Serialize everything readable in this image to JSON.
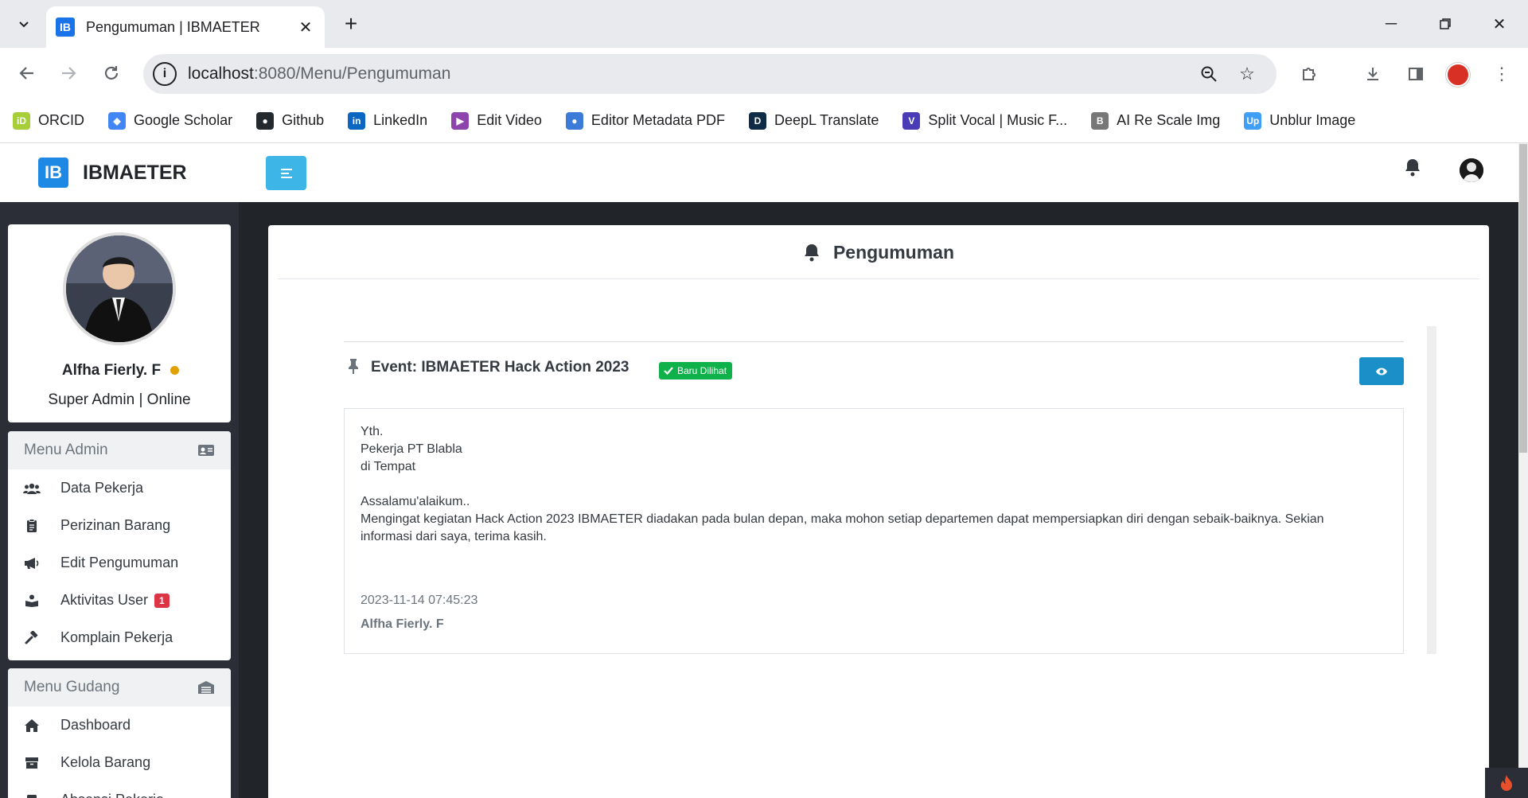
{
  "browser": {
    "tab_title": "Pengumuman | IBMAETER",
    "tab_favicon": "IB",
    "url_host": "localhost",
    "url_rest": ":8080/Menu/Pengumuman",
    "bookmarks": [
      {
        "label": "ORCID",
        "icon": "orcid-icon",
        "color": "#a6ce39",
        "glyph": "iD"
      },
      {
        "label": "Google Scholar",
        "icon": "scholar-icon",
        "color": "#4285f4",
        "glyph": "◆"
      },
      {
        "label": "Github",
        "icon": "github-icon",
        "color": "#24292e",
        "glyph": "●"
      },
      {
        "label": "LinkedIn",
        "icon": "linkedin-icon",
        "color": "#0a66c2",
        "glyph": "in"
      },
      {
        "label": "Edit Video",
        "icon": "edit-video-icon",
        "color": "#8e44ad",
        "glyph": "▶"
      },
      {
        "label": "Editor Metadata PDF",
        "icon": "metadata-icon",
        "color": "#3d7bd9",
        "glyph": "●"
      },
      {
        "label": "DeepL Translate",
        "icon": "deepl-icon",
        "color": "#0f2b46",
        "glyph": "D"
      },
      {
        "label": "Split Vocal | Music F...",
        "icon": "split-vocal-icon",
        "color": "#4a3bb7",
        "glyph": "V"
      },
      {
        "label": "AI Re Scale Img",
        "icon": "rescale-icon",
        "color": "#777777",
        "glyph": "B"
      },
      {
        "label": "Unblur Image",
        "icon": "unblur-icon",
        "color": "#3f9ef5",
        "glyph": "Up"
      }
    ]
  },
  "app": {
    "brand_logo": "IB",
    "brand_name": "IBMAETER",
    "accent": "#3db5e6",
    "profile": {
      "name": "Alfha Fierly. F",
      "role": "Super Admin | Online",
      "status_color": "#e0a000"
    },
    "menu_admin": {
      "title": "Menu Admin",
      "items": [
        {
          "label": "Data Pekerja",
          "icon": "users-icon"
        },
        {
          "label": "Perizinan Barang",
          "icon": "clipboard-icon"
        },
        {
          "label": "Edit Pengumuman",
          "icon": "megaphone-icon"
        },
        {
          "label": "Aktivitas User",
          "icon": "user-activity-icon",
          "badge": "1"
        },
        {
          "label": "Komplain Pekerja",
          "icon": "gavel-icon"
        }
      ]
    },
    "menu_gudang": {
      "title": "Menu Gudang",
      "items": [
        {
          "label": "Dashboard",
          "icon": "home-icon"
        },
        {
          "label": "Kelola Barang",
          "icon": "box-icon"
        },
        {
          "label": "Absensi Pekerja",
          "icon": "clipboard-check-icon"
        }
      ]
    }
  },
  "main": {
    "page_title": "Pengumuman",
    "announcement": {
      "title": "Event: IBMAETER Hack Action 2023",
      "badge": "Baru Dilihat",
      "badge_color": "#0fb14b",
      "lines": [
        "Yth.",
        "Pekerja PT Blabla",
        "di Tempat",
        "",
        "Assalamu'alaikum..",
        "Mengingat kegiatan Hack Action 2023 IBMAETER diadakan pada bulan depan, maka mohon setiap departemen dapat mempersiapkan diri dengan sebaik-baiknya. Sekian",
        "informasi dari saya, terima kasih."
      ],
      "date": "2023-11-14 07:45:23",
      "author": "Alfha Fierly. F"
    }
  }
}
